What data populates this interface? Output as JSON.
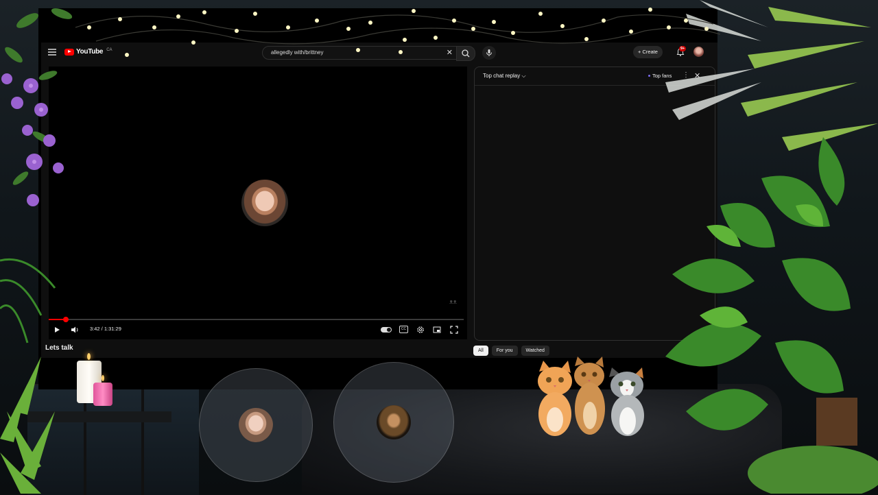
{
  "youtube": {
    "logo_text": "YouTube",
    "country_code": "CA",
    "search_query": "allegedly with/brittney",
    "create_label": "+ Create",
    "notification_count": "9+"
  },
  "player": {
    "time_display": "3:42 / 1:31:29",
    "progress_fraction": 0.04,
    "cc_label": "CC",
    "watermark": "ᴥᴥ"
  },
  "chat": {
    "title": "Top chat replay ⌵",
    "top_fans_label": "Top fans",
    "kebab": "⋮",
    "close": "✕"
  },
  "below_video": {
    "title": "Lets talk"
  },
  "filter_chips": [
    "All",
    "For you",
    "Watched"
  ],
  "icons": {
    "menu": "menu-icon",
    "search": "search-icon",
    "mic": "mic-icon",
    "bell": "bell-icon",
    "play": "play-icon",
    "volume": "volume-icon",
    "settings": "gear-icon",
    "miniplayer": "miniplayer-icon",
    "fullscreen": "fullscreen-icon",
    "clear": "✕"
  },
  "colors": {
    "accent": "#ff0000",
    "background": "#0f0f0f",
    "chip_active": "#f1f1f1",
    "chip": "#272727",
    "top_fans_dot": "#7c6cf0"
  }
}
